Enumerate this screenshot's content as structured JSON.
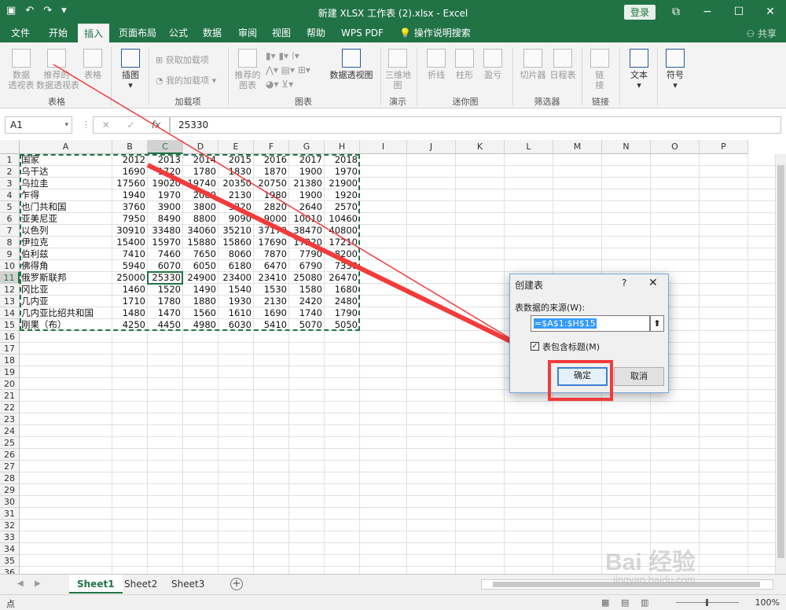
{
  "titlebar": {
    "title": "新建 XLSX 工作表 (2).xlsx  -  Excel",
    "login": "登录",
    "save_icon": "save-icon",
    "undo": "↶",
    "redo": "↷",
    "min": "−",
    "max": "☐",
    "close": "✕",
    "restore": "⧉"
  },
  "tabs": [
    {
      "label": "文件"
    },
    {
      "label": "开始"
    },
    {
      "label": "插入"
    },
    {
      "label": "页面布局"
    },
    {
      "label": "公式"
    },
    {
      "label": "数据"
    },
    {
      "label": "审阅"
    },
    {
      "label": "视图"
    },
    {
      "label": "帮助"
    },
    {
      "label": "WPS PDF"
    },
    {
      "label": "操作说明搜索"
    }
  ],
  "share": "共享",
  "ribbon": {
    "pivot": "数据\n透视表",
    "recommended_pivot": "推荐的\n数据透视表",
    "table": "表格",
    "illustrations": "插图",
    "get_addins": "获取加载项",
    "my_addins": "我的加载项",
    "rec_charts": "推荐的\n图表",
    "pivot_chart": "数据透视图",
    "map3d": "三维地\n图",
    "line": "折线",
    "column": "柱形",
    "winloss": "盈亏",
    "slicer": "切片器",
    "timeline": "日程表",
    "link": "链\n接",
    "text": "文本",
    "symbol": "符号",
    "groups": {
      "tables": "表格",
      "addins": "加载项",
      "charts": "图表",
      "tours": "演示",
      "sparklines": "迷你图",
      "filters": "筛选器",
      "links": "链接"
    }
  },
  "formula": {
    "namebox": "A1",
    "value": "25330",
    "fx": "fx"
  },
  "columns": [
    "A",
    "B",
    "C",
    "D",
    "E",
    "F",
    "G",
    "H",
    "I",
    "J",
    "K",
    "L",
    "M",
    "N",
    "O",
    "P"
  ],
  "rows": [
    "1",
    "2",
    "3",
    "4",
    "5",
    "6",
    "7",
    "8",
    "9",
    "10",
    "11",
    "12",
    "13",
    "14",
    "15",
    "16",
    "17",
    "18",
    "19",
    "20",
    "21",
    "22",
    "23",
    "24",
    "25",
    "26",
    "27",
    "28",
    "29",
    "30",
    "31",
    "32",
    "33",
    "34",
    "35",
    "36"
  ],
  "sheet": [
    [
      "国家",
      "2012",
      "2013",
      "2014",
      "2015",
      "2016",
      "2017",
      "2018"
    ],
    [
      "乌干达",
      "1690",
      "1720",
      "1780",
      "1830",
      "1870",
      "1900",
      "1970"
    ],
    [
      "乌拉圭",
      "17560",
      "19020",
      "19740",
      "20350",
      "20750",
      "21380",
      "21900"
    ],
    [
      "乍得",
      "1940",
      "1970",
      "2080",
      "2130",
      "1980",
      "1900",
      "1920"
    ],
    [
      "也门共和国",
      "3760",
      "3900",
      "3800",
      "3220",
      "2820",
      "2640",
      "2570"
    ],
    [
      "亚美尼亚",
      "7950",
      "8490",
      "8800",
      "9090",
      "9000",
      "10010",
      "10460"
    ],
    [
      "以色列",
      "30910",
      "33480",
      "34060",
      "35210",
      "37170",
      "38470",
      "40800"
    ],
    [
      "伊拉克",
      "15400",
      "15970",
      "15880",
      "15860",
      "17690",
      "17220",
      "17210"
    ],
    [
      "伯利兹",
      "7410",
      "7460",
      "7650",
      "8060",
      "7870",
      "7790",
      "8200"
    ],
    [
      "佛得角",
      "5940",
      "6070",
      "6050",
      "6180",
      "6470",
      "6790",
      "7330"
    ],
    [
      "俄罗斯联邦",
      "25000",
      "25330",
      "24900",
      "23400",
      "23410",
      "25080",
      "26470"
    ],
    [
      "冈比亚",
      "1460",
      "1520",
      "1490",
      "1540",
      "1530",
      "1580",
      "1680"
    ],
    [
      "几内亚",
      "1710",
      "1780",
      "1880",
      "1930",
      "2130",
      "2420",
      "2480"
    ],
    [
      "几内亚比绍共和国",
      "1480",
      "1470",
      "1560",
      "1610",
      "1690",
      "1740",
      "1790"
    ],
    [
      "刚果（布）",
      "4250",
      "4450",
      "4980",
      "6030",
      "5410",
      "5070",
      "5050"
    ]
  ],
  "sheets": [
    "Sheet1",
    "Sheet2",
    "Sheet3"
  ],
  "status": {
    "mode": "点",
    "zoom": "100%"
  },
  "dialog": {
    "title": "创建表",
    "help": "?",
    "close": "✕",
    "source_label": "表数据的来源(W):",
    "range": "=$A$1:$H$15",
    "has_headers": "表包含标题(M)",
    "ok": "确定",
    "cancel": "取消"
  },
  "watermark": {
    "line1": "Bai 经验",
    "line2": "jingyan.baidu.com"
  },
  "colors": {
    "accent": "#217346",
    "annotation": "#f23b3b"
  }
}
